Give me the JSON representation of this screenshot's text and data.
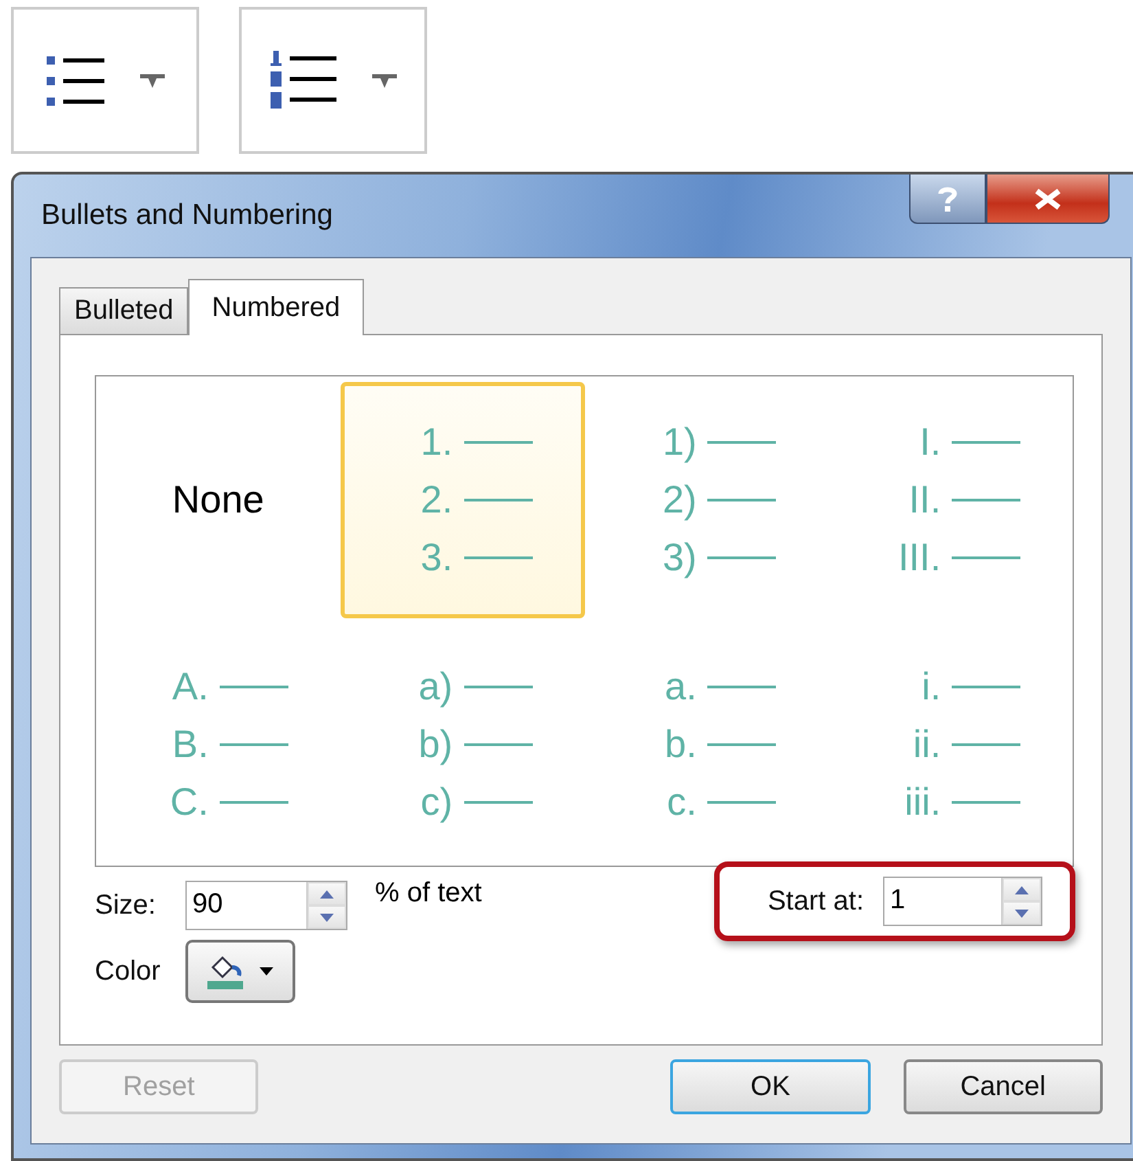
{
  "toolbar": [
    {
      "kind": "bullets"
    },
    {
      "kind": "numbering"
    }
  ],
  "window": {
    "title": "Bullets and Numbering"
  },
  "tabs": [
    {
      "label": "Bulleted",
      "selected": false
    },
    {
      "label": "Numbered",
      "selected": true
    }
  ],
  "gallery": [
    {
      "kind": "none",
      "label": "None",
      "selected": false
    },
    {
      "kind": "list",
      "markers": [
        "1.",
        "2.",
        "3."
      ],
      "selected": true
    },
    {
      "kind": "list",
      "markers": [
        "1)",
        "2)",
        "3)"
      ],
      "selected": false
    },
    {
      "kind": "list",
      "markers": [
        "I.",
        "II.",
        "III."
      ],
      "selected": false
    },
    {
      "kind": "list",
      "markers": [
        "A.",
        "B.",
        "C."
      ],
      "selected": false
    },
    {
      "kind": "list",
      "markers": [
        "a)",
        "b)",
        "c)"
      ],
      "selected": false
    },
    {
      "kind": "list",
      "markers": [
        "a.",
        "b.",
        "c."
      ],
      "selected": false
    },
    {
      "kind": "list",
      "markers": [
        "i.",
        "ii.",
        "iii."
      ],
      "selected": false
    }
  ],
  "size": {
    "label": "Size:",
    "value": "90",
    "suffix": "% of text"
  },
  "start_at": {
    "label": "Start at:",
    "value": "1",
    "highlighted": true
  },
  "color": {
    "label": "Color",
    "color": "#4fa88f"
  },
  "buttons": [
    {
      "label": "Reset",
      "disabled": true,
      "default": false
    },
    {
      "label": "OK",
      "disabled": false,
      "default": true
    },
    {
      "label": "Cancel",
      "disabled": false,
      "default": false
    }
  ]
}
